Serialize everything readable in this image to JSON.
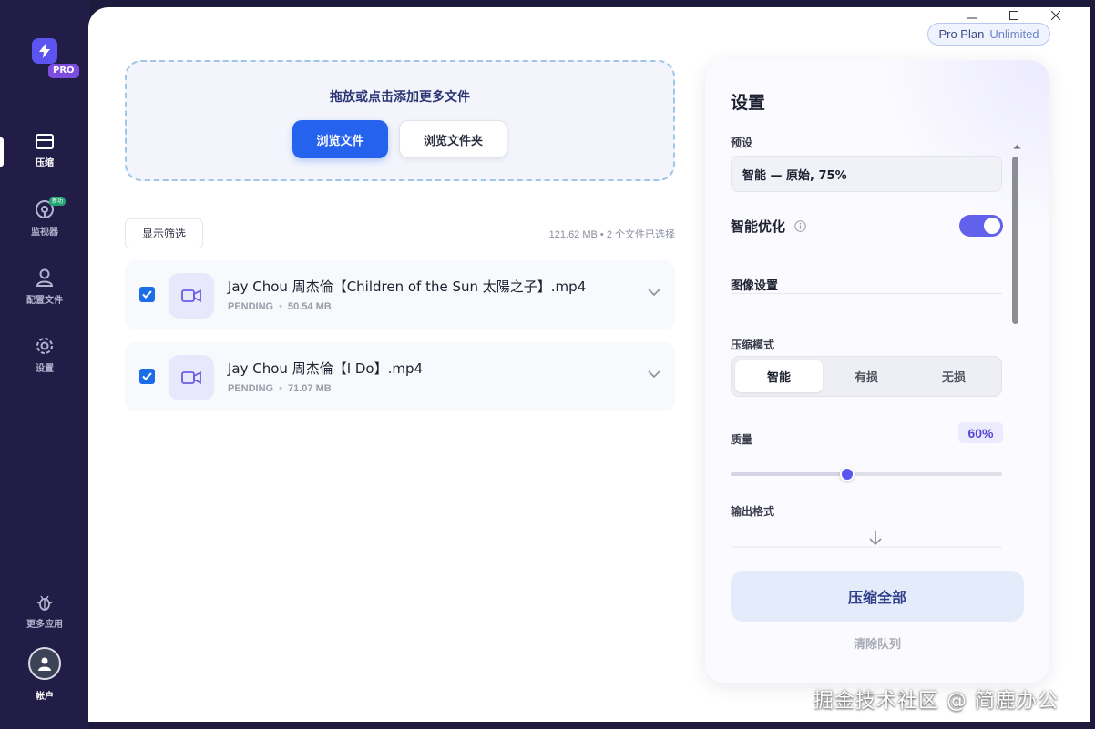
{
  "sidebar": {
    "logo_badge": "PRO",
    "items": [
      {
        "label": "压缩",
        "icon": "box-icon",
        "active": true
      },
      {
        "label": "监视器",
        "icon": "monitor-icon",
        "badge": "新功"
      },
      {
        "label": "配置文件",
        "icon": "user-icon"
      },
      {
        "label": "设置",
        "icon": "gear-icon"
      }
    ],
    "more_apps": {
      "label": "更多应用",
      "icon": "bug-icon"
    },
    "account": {
      "label": "帐户",
      "icon": "person-icon"
    }
  },
  "plan": {
    "name": "Pro Plan",
    "tier": "Unlimited"
  },
  "dropzone": {
    "title": "拖放或点击添加更多文件",
    "browse_files": "浏览文件",
    "browse_folder": "浏览文件夹"
  },
  "list": {
    "filter_label": "显示筛选",
    "summary": "121.62 MB • 2 个文件已选择",
    "files": [
      {
        "name": "Jay Chou 周杰倫【Children of the Sun 太陽之子】.mp4",
        "status": "PENDING",
        "size": "50.54 MB",
        "checked": true
      },
      {
        "name": "Jay Chou 周杰倫【I Do】.mp4",
        "status": "PENDING",
        "size": "71.07 MB",
        "checked": true
      }
    ]
  },
  "settings": {
    "title": "设置",
    "preset_label": "预设",
    "preset_value": "智能 — 原始, 75%",
    "smart_opt_label": "智能优化",
    "smart_opt_on": true,
    "image_section": "图像设置",
    "mode_label": "压缩模式",
    "modes": [
      "智能",
      "有损",
      "无损"
    ],
    "mode_selected": 0,
    "quality_label": "质量",
    "quality_value": "60%",
    "quality_fraction": 0.43,
    "output_label": "输出格式",
    "compress_all": "压缩全部",
    "clear_queue": "清除队列"
  },
  "watermark": "掘金技术社区 @ 简鹿办公",
  "colors": {
    "accent": "#2563ee",
    "toggle": "#6161ec",
    "sidebar": "#221d47"
  }
}
